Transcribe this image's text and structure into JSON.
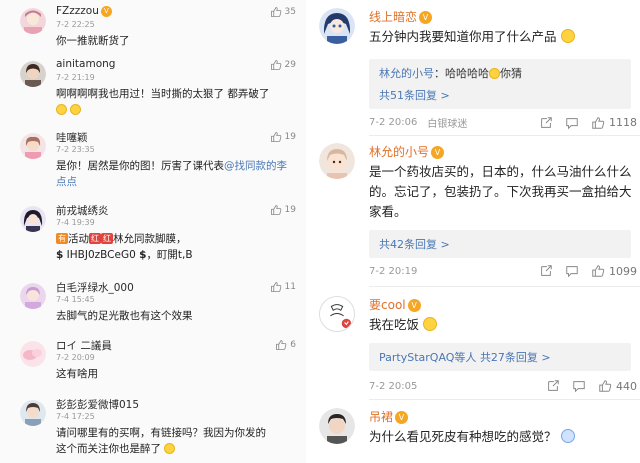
{
  "left": {
    "comments": [
      {
        "name": "FZzzzou",
        "time": "7-2 22:25",
        "likes": "35",
        "text": "你一推就断货了"
      },
      {
        "name": "ainitamong",
        "time": "7-2 21:19",
        "likes": "29",
        "text": "啊啊啊啊我也用过！当时撕的太狠了 都弄破了"
      },
      {
        "name": "哇噻颖",
        "time": "7-2 23:35",
        "likes": "19",
        "text_a": "是你！居然是你的图！厉害了课代表",
        "link": "@找同款的李点点"
      },
      {
        "name": "前戎城绣炎",
        "time": "7-4 19:39",
        "likes": "19",
        "line1_a": "活动",
        "line1_b": "林允同款脚膜，",
        "line2": "IHBJ0zBCeG0",
        "line2_b": "，町開t,B"
      },
      {
        "name": "白毛浮绿水_000",
        "time": "7-4 15:45",
        "likes": "11",
        "text": "去脚气的足光散也有这个效果"
      },
      {
        "name": "ロイ 二議員",
        "time": "7-2 20:09",
        "likes": "6",
        "text": "这有啥用"
      },
      {
        "name": "彭彭彭爱微博015",
        "time": "7-4 17:25",
        "likes": "",
        "text_a": "请问哪里有的买啊，有链接吗？我因为你发的",
        "text_b": "这个而关注你也是醉了"
      }
    ]
  },
  "right": {
    "comments": [
      {
        "name": "线上暗恋",
        "text": "五分钟内我要知道你用了什么产品",
        "reply_user": "林允的小号",
        "reply_text": "：哈哈哈哈",
        "reply_text_b": "你猜",
        "reply_count": "共51条回复 >",
        "time": "7-2 20:06",
        "source": "白银球迷",
        "likes": "1118"
      },
      {
        "name": "林允的小号",
        "text": "是一个药妆店买的，日本的，什么马油什么什么的。忘记了，包装扔了。下次我再买一盒拍给大家看。",
        "reply_count": "共42条回复 >",
        "time": "7-2 20:19",
        "likes": "1099"
      },
      {
        "name": "要cool",
        "text": "我在吃饭",
        "reply_users": "PartyStarQAQ等人",
        "reply_count": "共27条回复 >",
        "time": "7-2 20:05",
        "likes": "440"
      },
      {
        "name": "吊裙",
        "text": "为什么看见死皮有种想吃的感觉？"
      }
    ]
  },
  "icons": {
    "like": "thumbs-up-icon",
    "share": "share-icon",
    "comment": "comment-icon",
    "vip": "vip-badge-icon",
    "verified": "verified-badge-icon",
    "yuan": "dollar-sign-icon"
  },
  "colors": {
    "link": "#4a77b4",
    "name_orange": "#e0702a",
    "badge": "#f5a623",
    "red_tag": "#e0443d"
  }
}
